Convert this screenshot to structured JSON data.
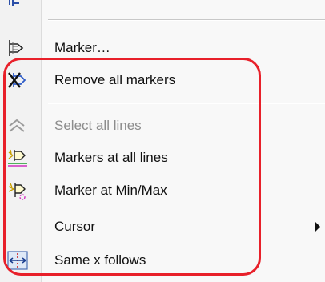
{
  "menu": {
    "items": [
      {
        "label": "Marker…",
        "icon": "marker-icon",
        "enabled": true
      },
      {
        "label": "Remove all markers",
        "icon": "remove-markers-icon",
        "enabled": true
      },
      {
        "label": "Select all lines",
        "icon": "select-lines-icon",
        "enabled": false
      },
      {
        "label": "Markers at all lines",
        "icon": "markers-all-lines-icon",
        "enabled": true
      },
      {
        "label": "Marker at Min/Max",
        "icon": "marker-minmax-icon",
        "enabled": true
      },
      {
        "label": "Cursor",
        "icon": "",
        "enabled": true,
        "submenu": true
      },
      {
        "label": "Same x follows",
        "icon": "same-x-follows-icon",
        "enabled": true
      }
    ]
  },
  "colors": {
    "highlight": "#e8202a",
    "disabled_text": "#8c8c8c"
  }
}
